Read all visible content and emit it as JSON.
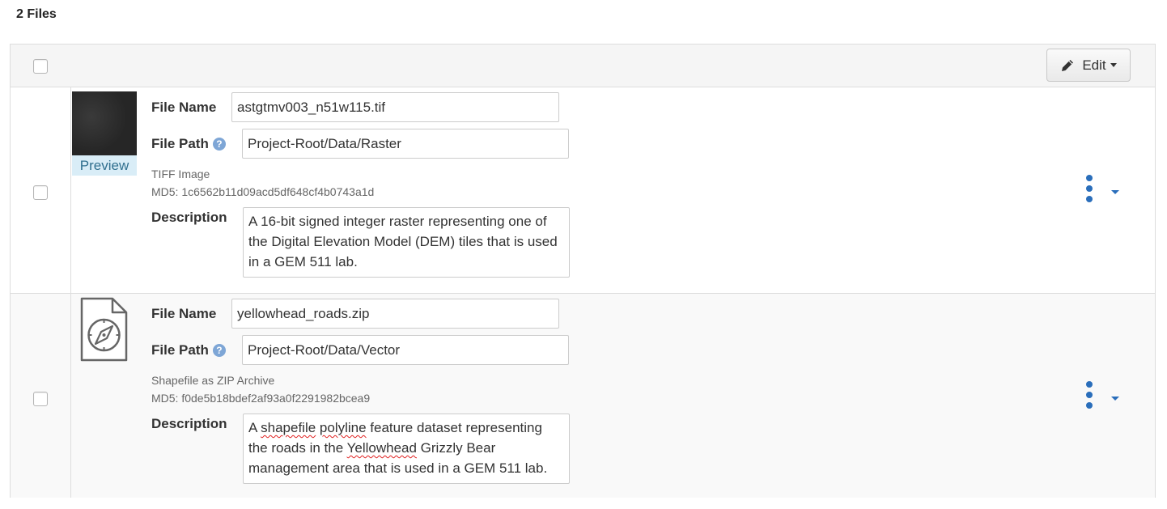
{
  "header": {
    "file_count": "2 Files"
  },
  "toolbar": {
    "edit_label": "Edit"
  },
  "labels": {
    "file_name": "File Name",
    "file_path": "File Path",
    "description": "Description",
    "help_glyph": "?"
  },
  "files": [
    {
      "file_name": "astgtmv003_n51w115.tif",
      "file_path": "Project-Root/Data/Raster",
      "type": "TIFF Image",
      "md5": "MD5: 1c6562b11d09acd5df648cf4b0743a1d",
      "preview_label": "Preview",
      "description": "A 16-bit signed integer raster representing one of the Digital Elevation Model (DEM) tiles that is used in a GEM 511 lab."
    },
    {
      "file_name": "yellowhead_roads.zip",
      "file_path": "Project-Root/Data/Vector",
      "type": "Shapefile as ZIP Archive",
      "md5": "MD5: f0de5b18bdef2af93a0f2291982bcea9",
      "icon": "compass-file-icon",
      "description_parts": {
        "p1": "A ",
        "p2": "shapefile",
        "p3": " ",
        "p4": "polyline",
        "p5": " feature dataset representing the roads in the ",
        "p6": "Yellowhead",
        "p7": " Grizzly Bear management area that is used in a GEM 511 lab."
      }
    }
  ],
  "colors": {
    "accent": "#2a6ebb",
    "preview_bg": "#d9edf7",
    "preview_text": "#31708f",
    "border": "#dddddd"
  }
}
